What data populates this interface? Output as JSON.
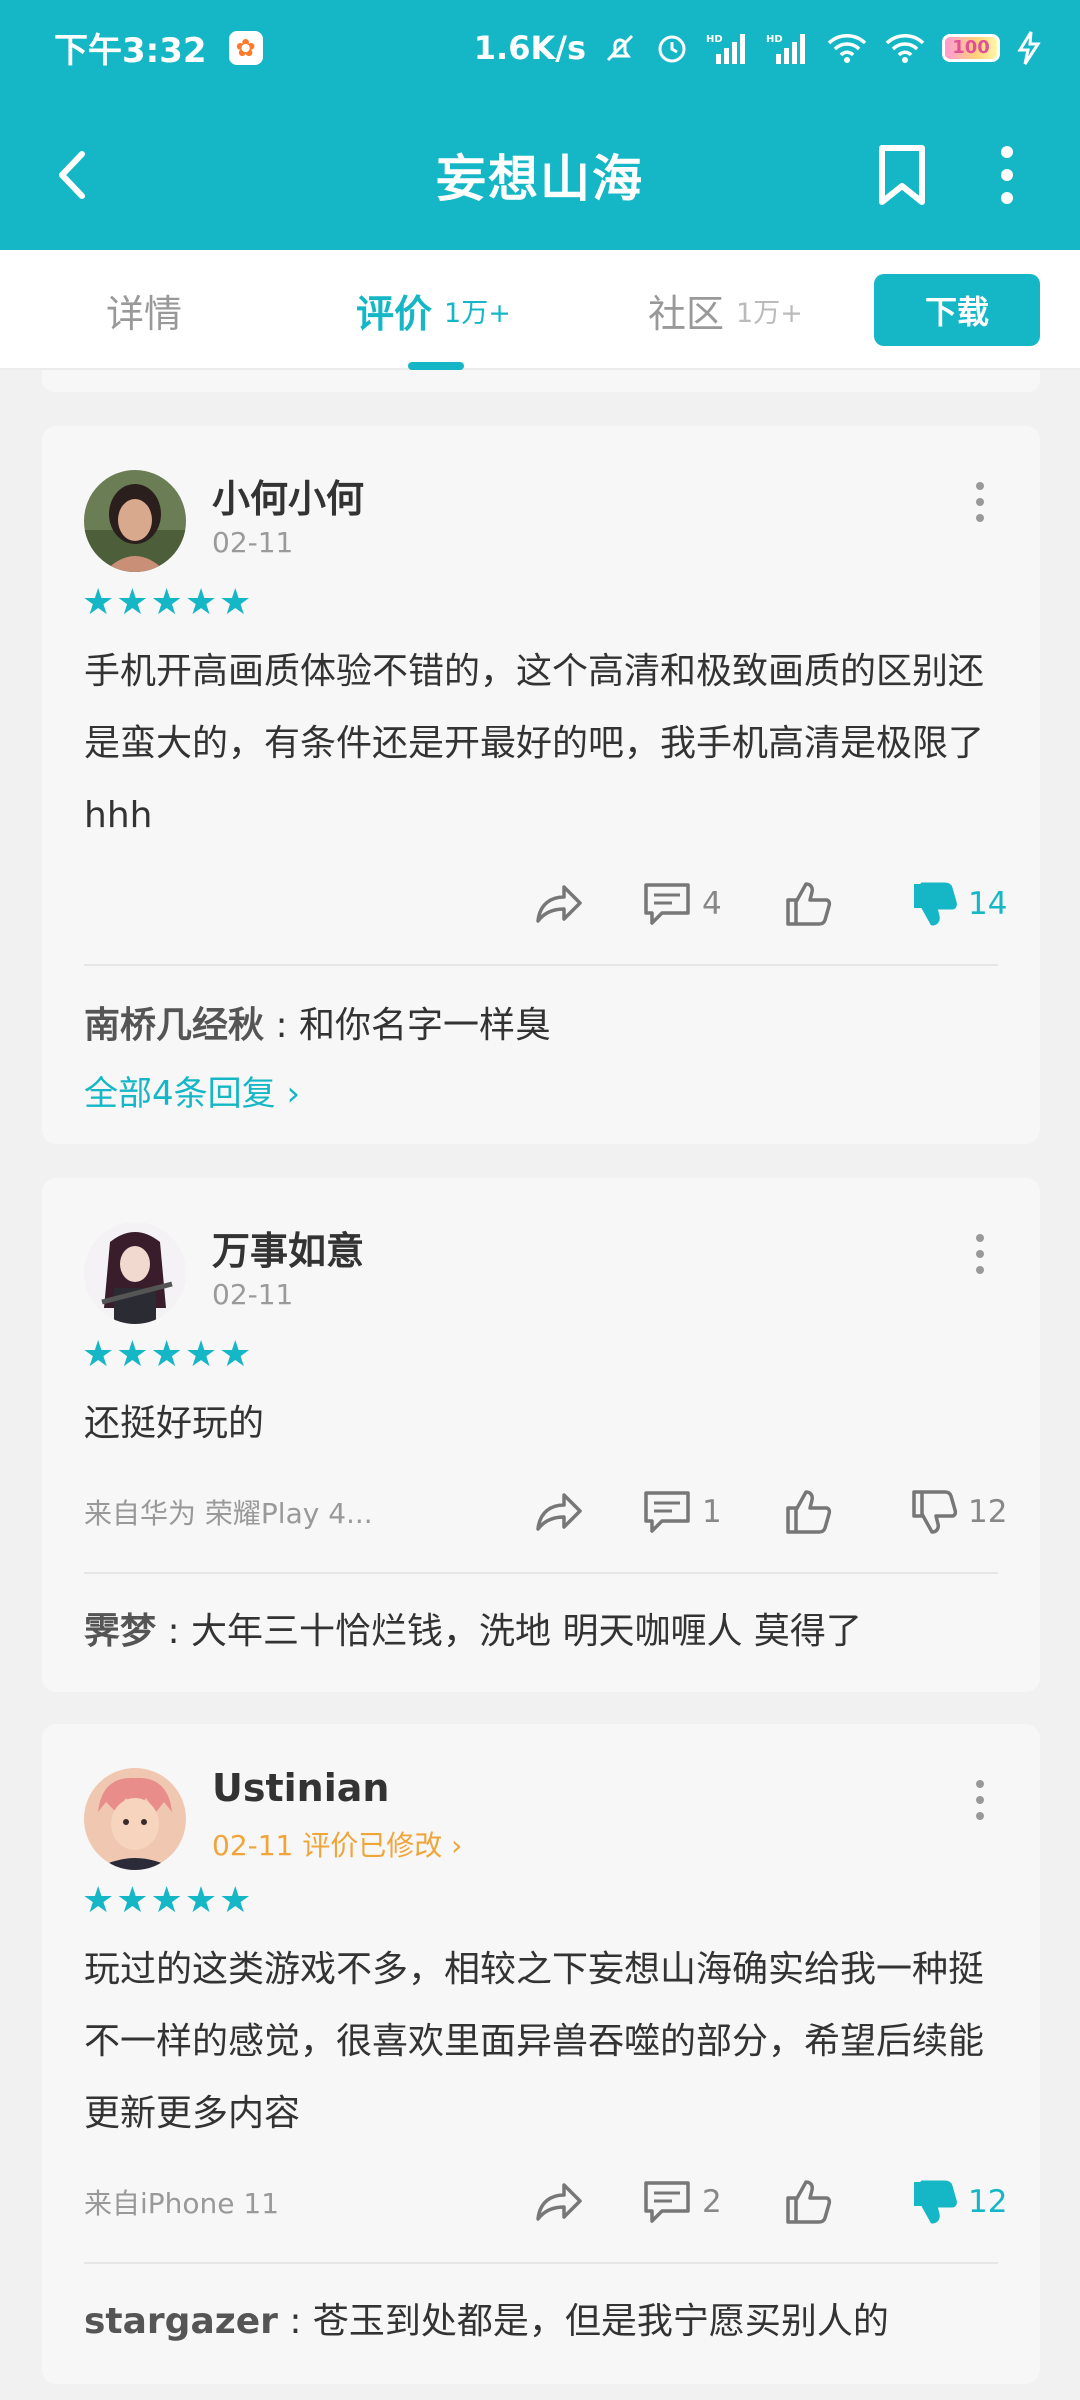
{
  "status_bar": {
    "time": "下午3:32",
    "speed": "1.6K/s",
    "battery": "100"
  },
  "header": {
    "title": "妄想山海"
  },
  "tabs": [
    {
      "label": "详情",
      "count": ""
    },
    {
      "label": "评价",
      "count": "1万+"
    },
    {
      "label": "社区",
      "count": "1万+"
    }
  ],
  "download_label": "下载",
  "reviews": [
    {
      "user": "小何小何",
      "date": "02-11",
      "stars": "★★★★★",
      "text": "手机开高画质体验不错的，这个高清和极致画质的区别还是蛮大的，有条件还是开最好的吧，我手机高清是极限了hhh",
      "device": "",
      "comments": "4",
      "dislikes": "14",
      "reply_user": "南桥几经秋",
      "reply_text": " : 和你名字一样臭",
      "all_replies": "全部4条回复 ›"
    },
    {
      "user": "万事如意",
      "date": "02-11",
      "stars": "★★★★★",
      "text": "还挺好玩的",
      "device": "来自华为 荣耀Play 4...",
      "comments": "1",
      "dislikes": "12",
      "reply_user": "霁梦",
      "reply_text": " : 大年三十恰烂钱，洗地 明天咖喱人 莫得了"
    },
    {
      "user": "Ustinian",
      "date": "02-11 评价已修改 ›",
      "stars": "★★★★★",
      "text": "玩过的这类游戏不多，相较之下妄想山海确实给我一种挺不一样的感觉，很喜欢里面异兽吞噬的部分，希望后续能更新更多内容",
      "device": "来自iPhone 11",
      "comments": "2",
      "dislikes": "12",
      "reply_user": "stargazer",
      "reply_text": " : 苍玉到处都是，但是我宁愿买别人的"
    }
  ],
  "colors": {
    "accent": "#15b7c6",
    "edited": "#f0a53a"
  }
}
